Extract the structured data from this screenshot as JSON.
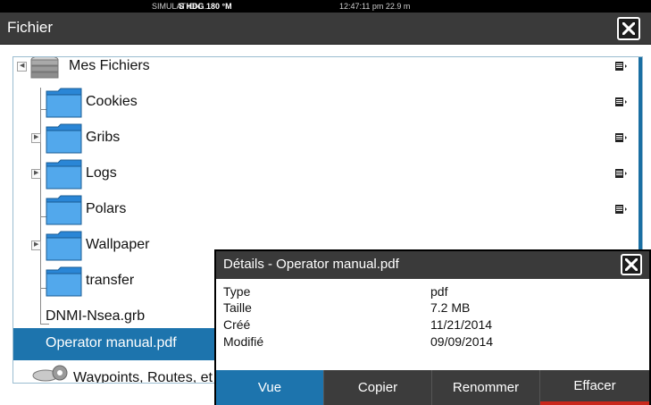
{
  "status_bar": {
    "sim": "SIMULATION...",
    "heading": "S HDG 180 °M",
    "time_depth": "12:47:11 pm  22.9 m"
  },
  "window": {
    "title": "Fichier"
  },
  "tree": {
    "items": [
      {
        "label": "Mes Fichiers",
        "icon": "drive-stack-icon",
        "expandable": true,
        "expanded": true
      },
      {
        "label": "Cookies",
        "icon": "folder-icon",
        "expandable": false
      },
      {
        "label": "Gribs",
        "icon": "folder-icon",
        "expandable": true
      },
      {
        "label": "Logs",
        "icon": "folder-icon",
        "expandable": true
      },
      {
        "label": "Polars",
        "icon": "folder-icon",
        "expandable": false
      },
      {
        "label": "Wallpaper",
        "icon": "folder-icon",
        "expandable": true
      },
      {
        "label": "transfer",
        "icon": "folder-icon",
        "expandable": false
      },
      {
        "label": "DNMI-Nsea.grb",
        "icon": "file",
        "expandable": false
      },
      {
        "label": "Operator manual.pdf",
        "icon": "file",
        "expandable": false,
        "selected": true
      },
      {
        "label": "Waypoints, Routes, et tra",
        "icon": "waypoint-database-icon",
        "expandable": false
      }
    ]
  },
  "details_dialog": {
    "title": "Détails - Operator manual.pdf",
    "rows": [
      {
        "label": "Type",
        "value": "pdf"
      },
      {
        "label": "Taille",
        "value": "7.2 MB"
      },
      {
        "label": "Créé",
        "value": "11/21/2014"
      },
      {
        "label": "Modifié",
        "value": "09/09/2014"
      }
    ],
    "buttons": {
      "view": "Vue",
      "copy": "Copier",
      "rename": "Renommer",
      "delete": "Effacer"
    }
  },
  "colors": {
    "selection": "#1d74ad",
    "titlebar": "#3a3a3a",
    "delete_accent": "#c9281c"
  }
}
